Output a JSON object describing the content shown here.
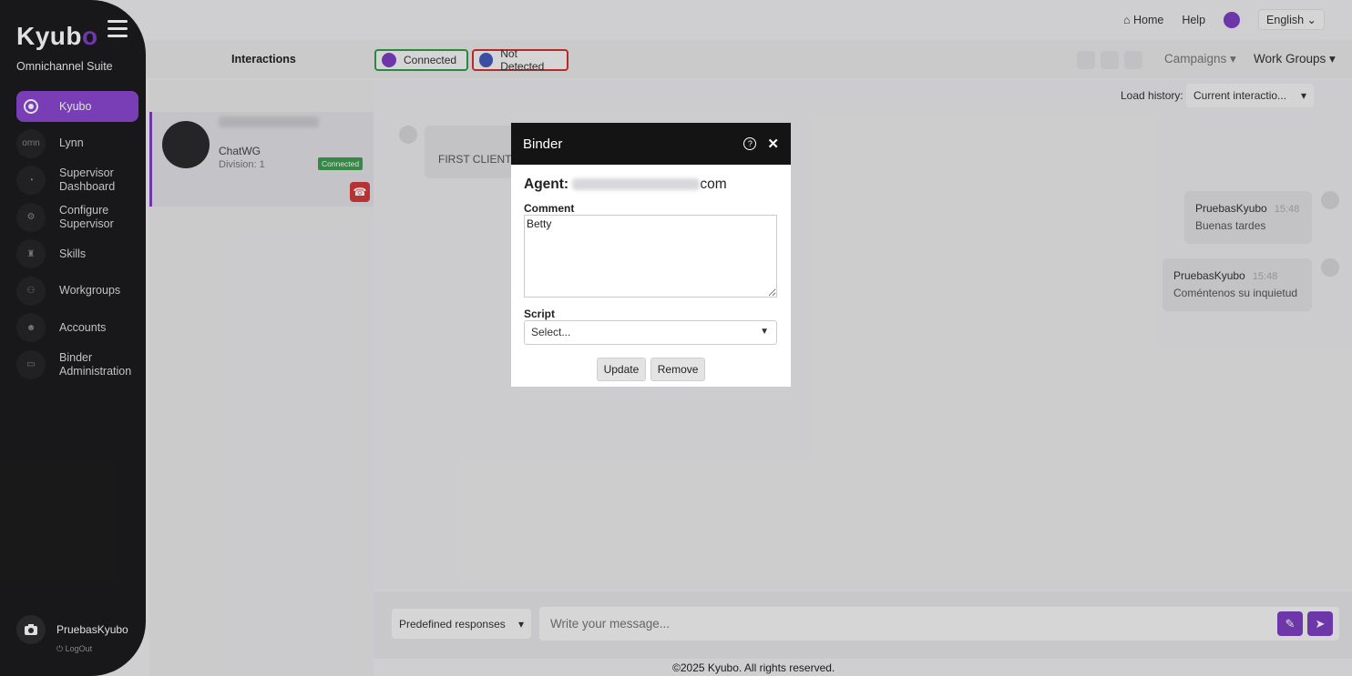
{
  "brand": {
    "logo": "Kyub",
    "logo_o": "o",
    "suite": "Omnichannel Suite"
  },
  "sidebar": {
    "items": [
      {
        "label": "Kyubo",
        "icon": "kyubo-icon"
      },
      {
        "label": "Lynn",
        "icon": "omn-icon",
        "icon_text": "omn"
      },
      {
        "label": "Supervisor Dashboard",
        "icon": "dashboard-icon"
      },
      {
        "label": "Configure Supervisor",
        "icon": "configure-icon"
      },
      {
        "label": "Skills",
        "icon": "skills-icon"
      },
      {
        "label": "Workgroups",
        "icon": "workgroups-icon"
      },
      {
        "label": "Accounts",
        "icon": "accounts-icon"
      },
      {
        "label": "Binder Administration",
        "icon": "binder-icon"
      }
    ],
    "user": "PruebasKyubo",
    "logout": "LogOut"
  },
  "topbar": {
    "home": "Home",
    "help": "Help",
    "language": "English"
  },
  "header": {
    "interactions": "Interactions",
    "connected": "Connected",
    "not_detected": "Not Detected",
    "campaigns": "Campaigns",
    "work_groups": "Work Groups"
  },
  "interaction_card": {
    "channel": "ChatWG",
    "division": "Division: 1",
    "status": "Connected"
  },
  "chat": {
    "load_history_label": "Load history:",
    "load_history_value": "Current interactio...",
    "first_client": "FIRST CLIENT M",
    "messages": [
      {
        "author": "PruebasKyubo",
        "time": "15:48",
        "text": "Buenas tardes"
      },
      {
        "author": "PruebasKyubo",
        "time": "15:48",
        "text": "Coméntenos su inquietud"
      }
    ]
  },
  "composer": {
    "predefined": "Predefined responses",
    "placeholder": "Write your message..."
  },
  "footer": "©2025 Kyubo. All rights reserved.",
  "modal": {
    "title": "Binder",
    "agent_label": "Agent:",
    "agent_suffix": "com",
    "comment_label": "Comment",
    "comment_value": "Betty",
    "script_label": "Script",
    "script_value": "Select...",
    "update": "Update",
    "remove": "Remove"
  }
}
